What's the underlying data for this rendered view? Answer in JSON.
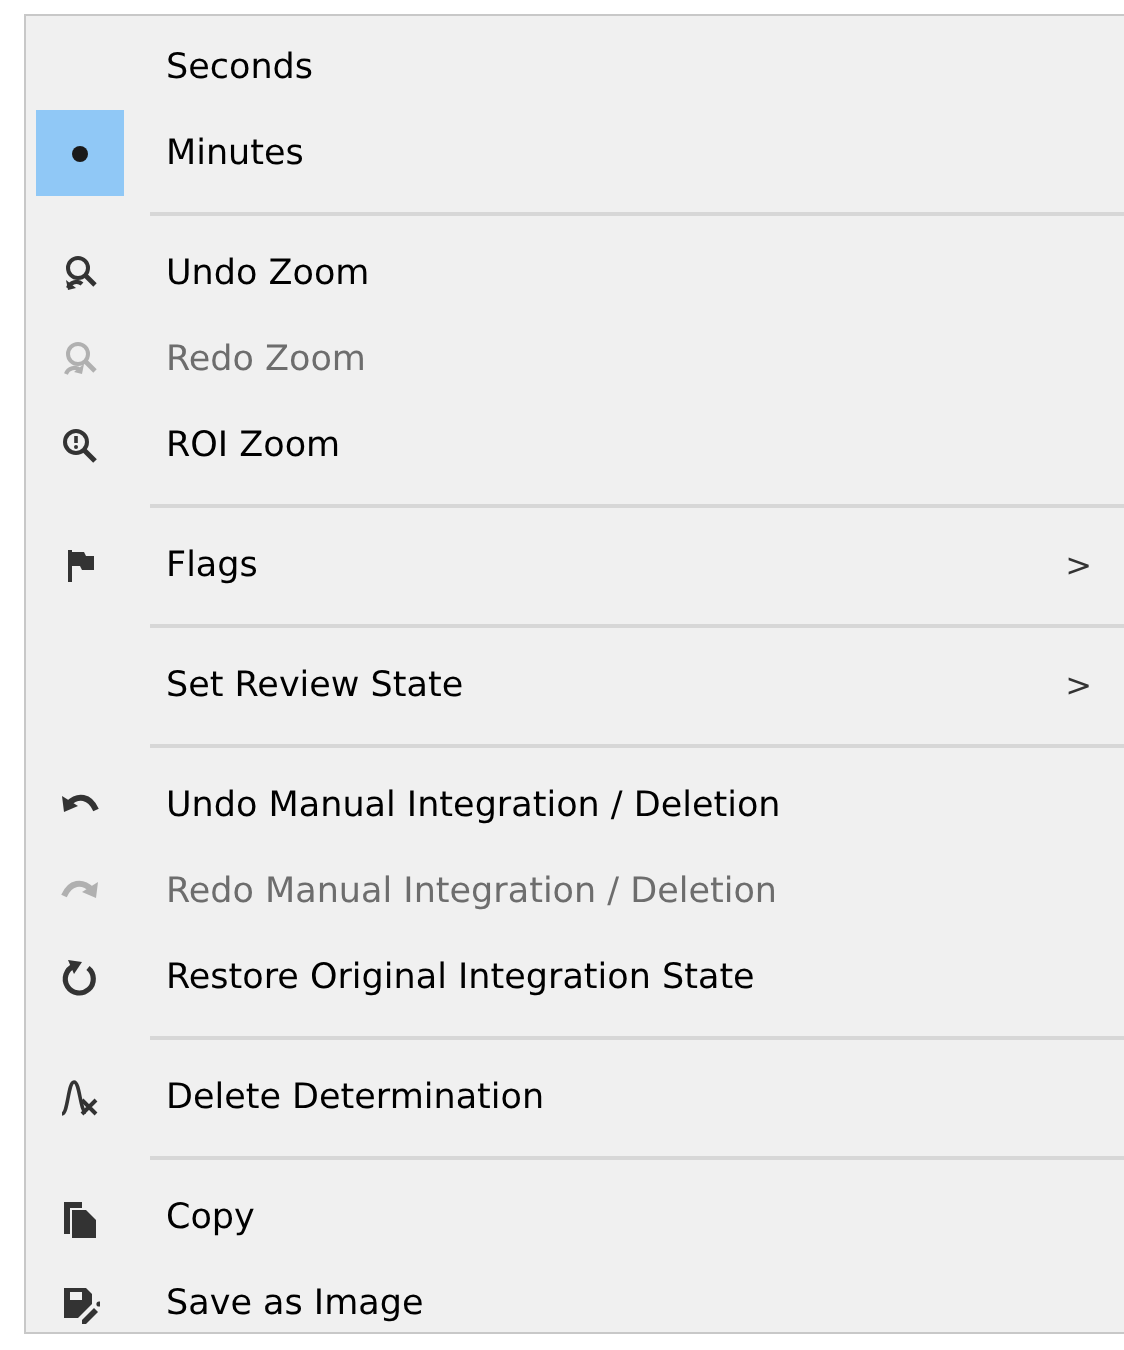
{
  "menu": {
    "items": [
      {
        "kind": "radio",
        "label": "Seconds",
        "selected": false
      },
      {
        "kind": "radio",
        "label": "Minutes",
        "selected": true
      },
      {
        "kind": "separator"
      },
      {
        "kind": "action",
        "label": "Undo Zoom",
        "disabled": false
      },
      {
        "kind": "action",
        "label": "Redo Zoom",
        "disabled": true
      },
      {
        "kind": "action",
        "label": "ROI Zoom",
        "disabled": false
      },
      {
        "kind": "separator"
      },
      {
        "kind": "submenu",
        "label": "Flags",
        "disabled": false,
        "arrow": ">"
      },
      {
        "kind": "separator"
      },
      {
        "kind": "submenu",
        "label": "Set Review State",
        "disabled": false,
        "arrow": ">"
      },
      {
        "kind": "separator"
      },
      {
        "kind": "action",
        "label": "Undo Manual Integration / Deletion",
        "disabled": false
      },
      {
        "kind": "action",
        "label": "Redo Manual Integration / Deletion",
        "disabled": true
      },
      {
        "kind": "action",
        "label": "Restore Original Integration State",
        "disabled": false
      },
      {
        "kind": "separator"
      },
      {
        "kind": "action",
        "label": "Delete Determination",
        "disabled": false
      },
      {
        "kind": "separator"
      },
      {
        "kind": "action",
        "label": "Copy",
        "disabled": false
      },
      {
        "kind": "action",
        "label": "Save as Image",
        "disabled": false
      }
    ]
  }
}
